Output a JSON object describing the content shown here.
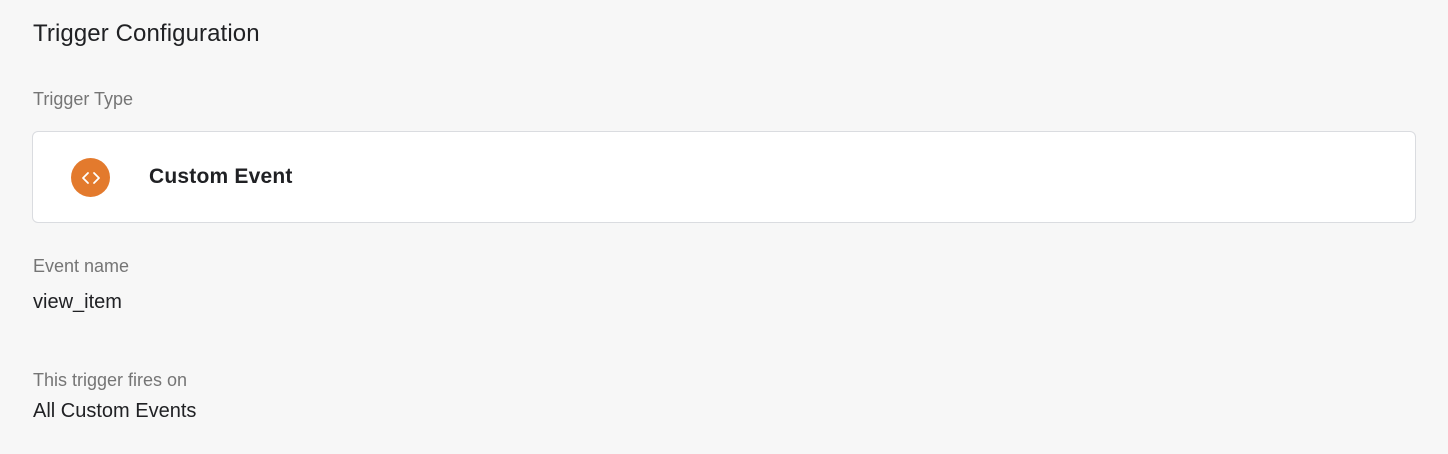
{
  "section": {
    "title": "Trigger Configuration"
  },
  "trigger_type": {
    "label": "Trigger Type",
    "name": "Custom Event",
    "icon": "code-brackets-icon",
    "icon_color": "#e37a2d"
  },
  "event_name": {
    "label": "Event name",
    "value": "view_item"
  },
  "fires_on": {
    "label": "This trigger fires on",
    "value": "All Custom Events"
  }
}
